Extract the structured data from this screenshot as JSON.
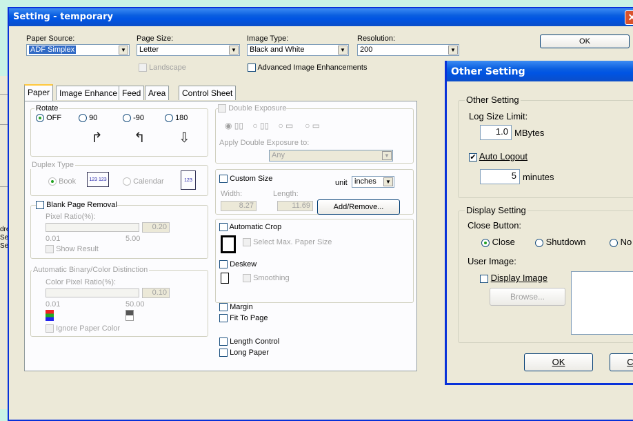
{
  "window": {
    "title": "Setting - temporary",
    "close_glyph": "✕"
  },
  "toolbar": {
    "paper_source_label": "Paper Source:",
    "paper_source_value": "ADF Simplex",
    "page_size_label": "Page Size:",
    "page_size_value": "Letter",
    "image_type_label": "Image Type:",
    "image_type_value": "Black and White",
    "resolution_label": "Resolution:",
    "resolution_value": "200",
    "ok_label": "OK",
    "landscape_label": "Landscape",
    "advanced_label": "Advanced Image Enhancements"
  },
  "tabs": [
    "Paper",
    "Image Enhance",
    "Feed",
    "Area",
    "Control Sheet"
  ],
  "rotate": {
    "title": "Rotate",
    "options": [
      "OFF",
      "90",
      "-90",
      "180"
    ],
    "selected": "OFF"
  },
  "duplex": {
    "title": "Duplex Type",
    "book": "Book",
    "calendar": "Calendar",
    "book_icon_text": "123 123",
    "cal_icon_text": "123"
  },
  "blank_page": {
    "title": "Blank Page Removal",
    "ratio_label": "Pixel Ratio(%):",
    "value": "0.20",
    "min": "0.01",
    "max": "5.00",
    "show_result": "Show Result"
  },
  "auto_binary": {
    "title": "Automatic Binary/Color Distinction",
    "ratio_label": "Color Pixel Ratio(%):",
    "value": "0.10",
    "min": "0.01",
    "max": "50.00",
    "ignore": "Ignore Paper Color"
  },
  "double_exposure": {
    "title": "Double Exposure",
    "apply_label": "Apply Double Exposure to:",
    "apply_value": "Any"
  },
  "custom_size": {
    "title": "Custom Size",
    "unit_label": "unit",
    "unit_value": "inches",
    "width_label": "Width:",
    "width_value": "8.27",
    "length_label": "Length:",
    "length_value": "11.69",
    "add_remove": "Add/Remove..."
  },
  "crop": {
    "auto_crop": "Automatic Crop",
    "select_max": "Select Max. Paper Size",
    "deskew": "Deskew",
    "smoothing": "Smoothing"
  },
  "misc": {
    "margin": "Margin",
    "fit_to_page": "Fit To Page",
    "length_control": "Length Control",
    "long_paper": "Long Paper"
  },
  "dialog": {
    "title": "Other Setting",
    "group1": "Other Setting",
    "log_size_label": "Log Size Limit:",
    "log_size_value": "1.0",
    "log_size_unit": "MBytes",
    "auto_logout": "Auto Logout",
    "auto_logout_value": "5",
    "auto_logout_unit": "minutes",
    "group2": "Display Setting",
    "close_button_label": "Close Button:",
    "close_options": [
      "Close",
      "Shutdown",
      "No"
    ],
    "user_image_label": "User Image:",
    "display_image": "Display Image",
    "browse": "Browse...",
    "ok": "OK",
    "cancel": "C"
  },
  "background": {
    "texts": [
      "dre",
      "Ser",
      "Ser"
    ]
  }
}
